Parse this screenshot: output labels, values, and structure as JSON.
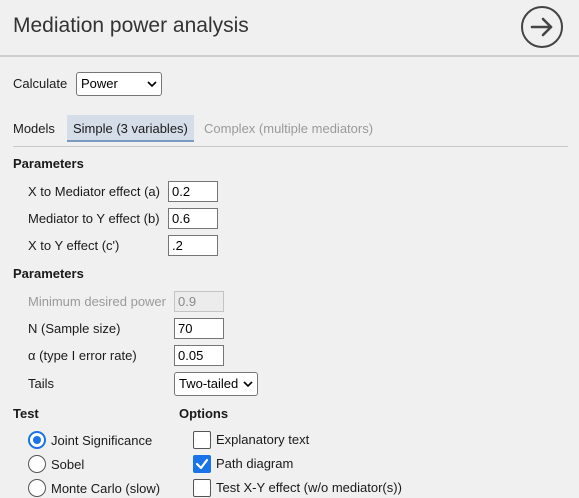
{
  "header": {
    "title": "Mediation power analysis",
    "go_icon": "arrow-right-circle-icon"
  },
  "calculate": {
    "label": "Calculate",
    "value": "Power"
  },
  "models": {
    "label": "Models",
    "tabs": [
      {
        "label": "Simple (3 variables)",
        "state": "active"
      },
      {
        "label": "Complex (multiple mediators)",
        "state": "disabled"
      }
    ]
  },
  "effects": {
    "heading": "Parameters",
    "rows": [
      {
        "label": "X to Mediator effect (a)",
        "value": "0.2"
      },
      {
        "label": "Mediator to Y effect (b)",
        "value": "0.6"
      },
      {
        "label": "X to Y effect (c')",
        "value": ".2"
      }
    ]
  },
  "params": {
    "heading": "Parameters",
    "min_power": {
      "label": "Minimum desired power",
      "value": "0.9"
    },
    "n": {
      "label": "N (Sample size)",
      "value": "70"
    },
    "alpha": {
      "label": "α (type I error rate)",
      "value": "0.05"
    },
    "tails": {
      "label": "Tails",
      "value": "Two-tailed"
    }
  },
  "test": {
    "heading": "Test",
    "options": [
      {
        "label": "Joint Significance",
        "checked": true
      },
      {
        "label": "Sobel",
        "checked": false
      },
      {
        "label": "Monte Carlo (slow)",
        "checked": false
      }
    ]
  },
  "options": {
    "heading": "Options",
    "items": [
      {
        "label": "Explanatory text",
        "checked": false
      },
      {
        "label": "Path diagram",
        "checked": true
      },
      {
        "label": "Test X-Y effect (w/o mediator(s))",
        "checked": false
      }
    ]
  },
  "colors": {
    "accent": "#1a73e8",
    "tab_active_bg": "#d5dde8"
  }
}
